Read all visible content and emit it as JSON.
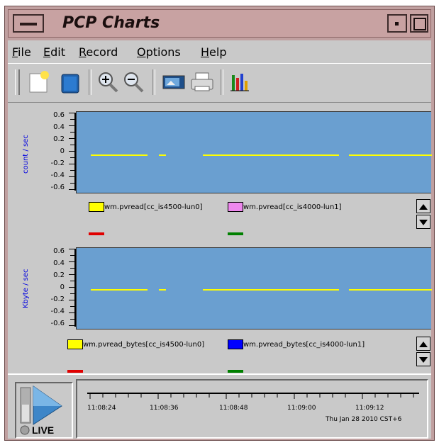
{
  "window": {
    "title": "PCP Charts"
  },
  "menubar": {
    "items": [
      {
        "label": "File",
        "accel": "F",
        "rest": "ile"
      },
      {
        "label": "Edit",
        "accel": "E",
        "rest": "dit"
      },
      {
        "label": "Record",
        "accel": "R",
        "rest": "ecord"
      },
      {
        "label": "Options",
        "accel": "O",
        "rest": "ptions"
      },
      {
        "label": "Help",
        "accel": "H",
        "rest": "elp"
      }
    ]
  },
  "toolbar": {
    "buttons": [
      {
        "icon": "new-chart-icon"
      },
      {
        "icon": "open-view-icon"
      },
      {
        "icon": "zoom-in-icon"
      },
      {
        "icon": "zoom-out-icon"
      },
      {
        "icon": "export-image-icon"
      },
      {
        "icon": "print-icon"
      },
      {
        "icon": "chart-options-icon"
      }
    ]
  },
  "charts": [
    {
      "ylabel": "count / sec",
      "yticks": [
        "0.6",
        "0.4",
        "0.2",
        "0",
        "-0.2",
        "-0.4",
        "-0.6"
      ],
      "legend": [
        {
          "label": "wm.pvread[cc_is4500-lun0]",
          "color": "#ffff00",
          "marker_color": "#e00000"
        },
        {
          "label": "wm.pvread[cc_is4000-lun1]",
          "color": "#ee88ee",
          "marker_color": "#008000"
        }
      ]
    },
    {
      "ylabel": "Kbyte / sec",
      "yticks": [
        "0.6",
        "0.4",
        "0.2",
        "0",
        "-0.2",
        "-0.4",
        "-0.6"
      ],
      "legend": [
        {
          "label": "wm.pvread_bytes[cc_is4500-lun0]",
          "color": "#ffff00",
          "marker_color": "#e00000"
        },
        {
          "label": "wm.pvread_bytes[cc_is4000-lun1]",
          "color": "#0000ff",
          "marker_color": "#008000"
        }
      ]
    }
  ],
  "chart_data": [
    {
      "type": "line",
      "ylabel": "count / sec",
      "ylim": [
        -0.6,
        0.6
      ],
      "series": [
        {
          "name": "wm.pvread[cc_is4500-lun0]",
          "values": [
            0,
            0,
            0,
            0,
            0,
            0
          ]
        }
      ]
    },
    {
      "type": "line",
      "ylabel": "Kbyte / sec",
      "ylim": [
        -0.6,
        0.6
      ],
      "series": [
        {
          "name": "wm.pvread_bytes[cc_is4500-lun0]",
          "values": [
            0,
            0,
            0,
            0,
            0,
            0
          ]
        }
      ]
    }
  ],
  "timeaxis": {
    "labels": [
      "11:08:24",
      "11:08:36",
      "11:08:48",
      "11:09:00",
      "11:09:12"
    ],
    "date": "Thu Jan 28 2010 CST+6"
  },
  "live": {
    "label": "LIVE"
  }
}
